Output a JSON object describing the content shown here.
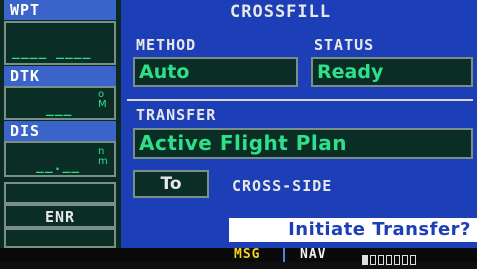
{
  "left_panel": {
    "wpt": {
      "label": "WPT",
      "value": "____ ____"
    },
    "dtk": {
      "label": "DTK",
      "value": "___",
      "unit": "o\nM"
    },
    "dis": {
      "label": "DIS",
      "value": "__.__",
      "unit": "n\nm"
    },
    "mode": {
      "label": "ENR"
    }
  },
  "main": {
    "title": "CROSSFILL",
    "method": {
      "label": "METHOD",
      "value": "Auto"
    },
    "status": {
      "label": "STATUS",
      "value": "Ready"
    },
    "transfer": {
      "label": "TRANSFER",
      "value": "Active Flight Plan"
    },
    "direction": {
      "value": "To",
      "target": "CROSS-SIDE"
    },
    "prompt": "Initiate Transfer?"
  },
  "status_bar": {
    "msg": "MSG",
    "nav": "NAV",
    "page_count": 7,
    "page_active": 1
  }
}
